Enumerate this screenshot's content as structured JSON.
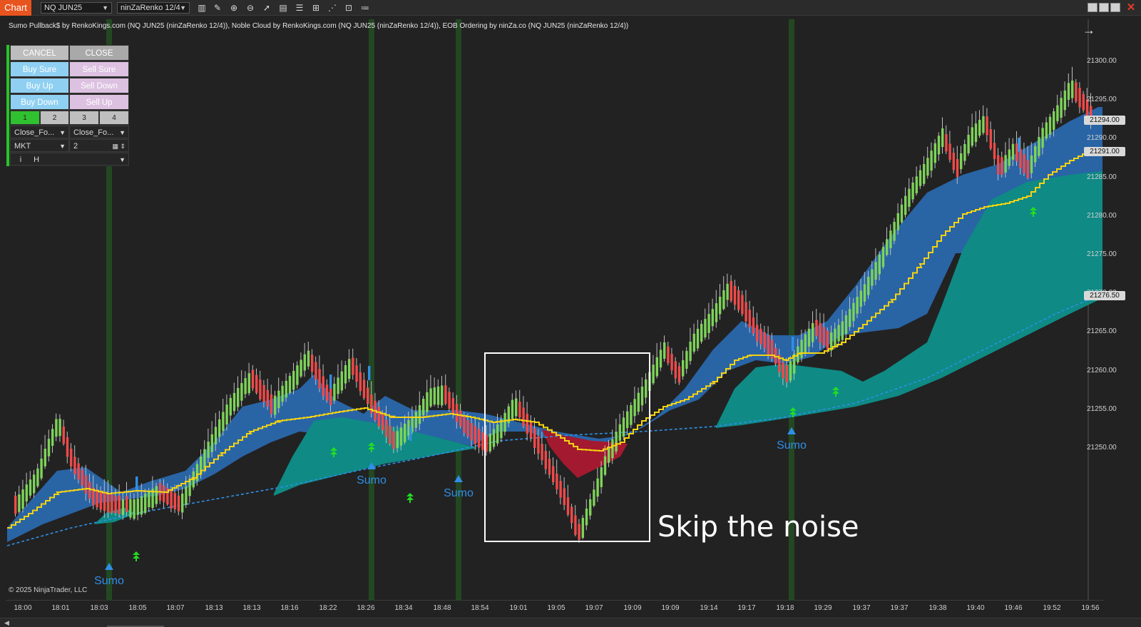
{
  "toolbar": {
    "chart_tab": "Chart",
    "instrument": "NQ JUN25",
    "bar_type": "ninZaRenko 12/4",
    "icons": [
      "bar-type-icon",
      "draw-icon",
      "zoom-in-icon",
      "zoom-out-icon",
      "cursor-icon",
      "properties-icon",
      "templates-icon",
      "indicators-icon",
      "strategies-icon",
      "data-box-icon",
      "list-icon"
    ]
  },
  "indicator_label": "Sumo Pullback$ by RenkoKings.com (NQ JUN25 (ninZaRenko 12/4)), Noble Cloud by RenkoKings.com (NQ JUN25 (ninZaRenko 12/4)), EOB Ordering by ninZa.co (NQ JUN25 (ninZaRenko 12/4))",
  "order_panel": {
    "cancel": "CANCEL",
    "close": "CLOSE",
    "buy_sure": "Buy Sure",
    "sell_sure": "Sell Sure",
    "buy_up": "Buy Up",
    "sell_down": "Sell Down",
    "buy_down": "Buy Down",
    "sell_up": "Sell Up",
    "qty_tabs": [
      "1",
      "2",
      "3",
      "4"
    ],
    "close_mode_left": "Close_Fo...",
    "close_mode_right": "Close_Fo...",
    "order_type": "MKT",
    "quantity": "2",
    "info": "i",
    "account": "H"
  },
  "price_axis": {
    "labels": [
      "21300.00",
      "21295.00",
      "21290.00",
      "21285.00",
      "21280.00",
      "21275.00",
      "21270.00",
      "21265.00",
      "21260.00",
      "21255.00",
      "21250.00"
    ],
    "tags": [
      "21294.00",
      "21291.00",
      "21276.50"
    ]
  },
  "time_axis": [
    "18:00",
    "18:01",
    "18:03",
    "18:05",
    "18:07",
    "18:13",
    "18:13",
    "18:16",
    "18:22",
    "18:26",
    "18:34",
    "18:48",
    "18:54",
    "19:01",
    "19:05",
    "19:07",
    "19:09",
    "19:09",
    "19:14",
    "19:17",
    "19:18",
    "19:29",
    "19:37",
    "19:37",
    "19:38",
    "19:40",
    "19:46",
    "19:52",
    "19:56"
  ],
  "signals": [
    "Sumo",
    "Sumo",
    "Sumo",
    "Sumo"
  ],
  "annotation": "Skip the noise",
  "copyright": "© 2025 NinjaTrader, LLC",
  "colors": {
    "up_candle": "#7ed35a",
    "down_candle": "#ef4a4a",
    "cloud_blue": "#2a68ad",
    "cloud_teal": "#0f8a85",
    "cloud_red": "#a3192f",
    "ma_yellow": "#f5d312",
    "baseline_dashed": "#2f8fe6",
    "session_band": "#234722",
    "signal_blue": "#2f8fe6",
    "arrow_green": "#22dd22"
  }
}
